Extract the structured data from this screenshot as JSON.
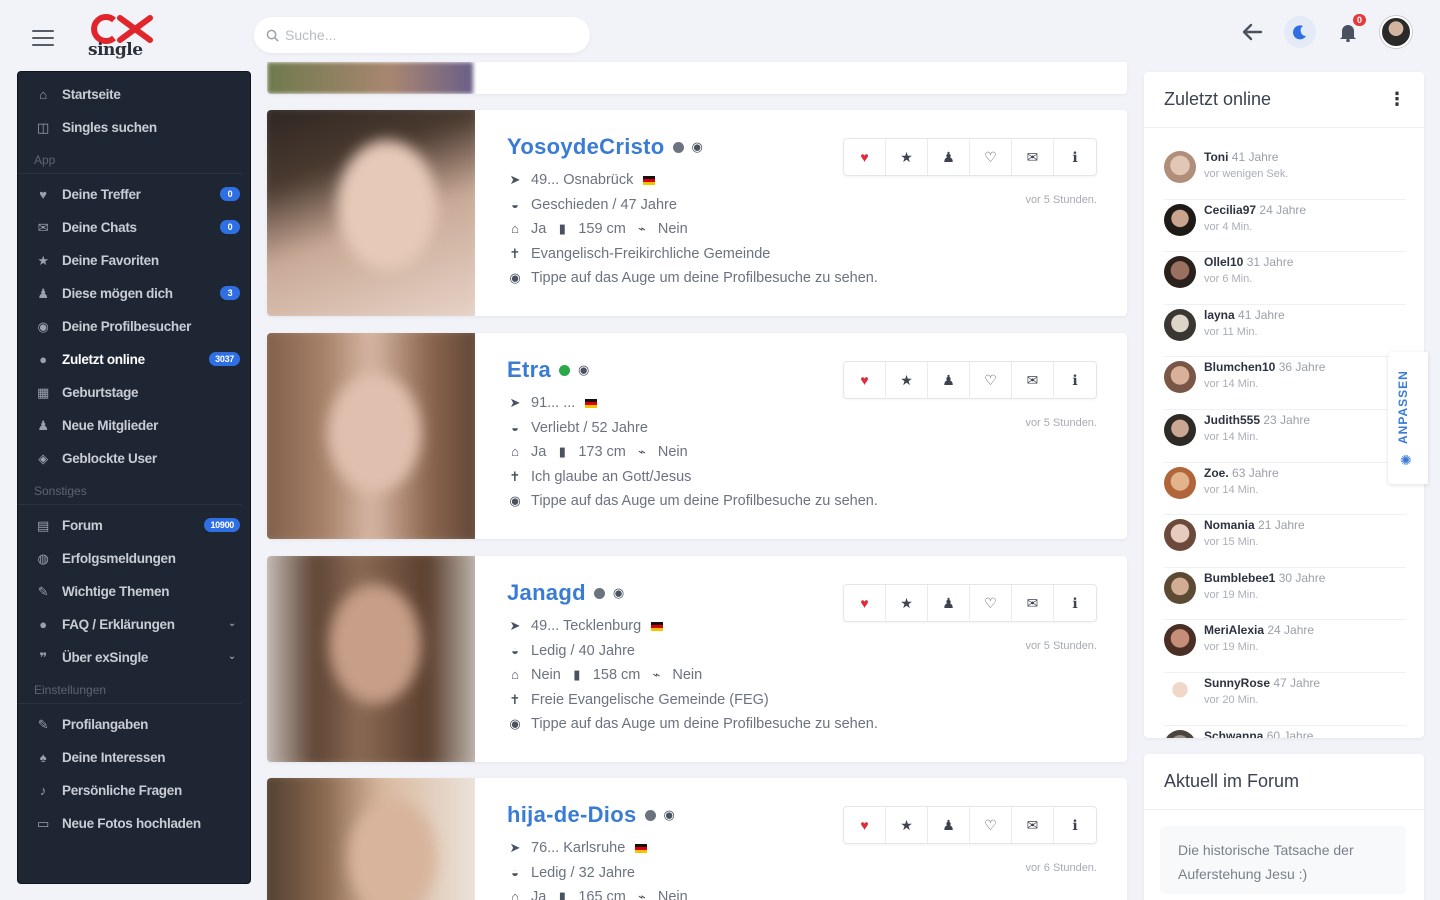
{
  "header": {
    "logo_text": "single",
    "search_placeholder": "Suche...",
    "notification_count": "0"
  },
  "sidebar": {
    "items": [
      {
        "label": "Startseite",
        "icon": "home-icon"
      },
      {
        "label": "Singles suchen",
        "icon": "binoculars-icon"
      }
    ],
    "sections": [
      {
        "title": "App",
        "items": [
          {
            "label": "Deine Treffer",
            "icon": "heart-icon",
            "count": "0"
          },
          {
            "label": "Deine Chats",
            "icon": "chat-icon",
            "count": "0"
          },
          {
            "label": "Deine Favoriten",
            "icon": "star-icon"
          },
          {
            "label": "Diese mögen dich",
            "icon": "user-icon",
            "count": "3"
          },
          {
            "label": "Deine Profilbesucher",
            "icon": "eye-icon"
          },
          {
            "label": "Zuletzt online",
            "icon": "clock-icon",
            "count": "3037",
            "active": true
          },
          {
            "label": "Geburtstage",
            "icon": "cake-icon"
          },
          {
            "label": "Neue Mitglieder",
            "icon": "users-icon"
          },
          {
            "label": "Geblockte User",
            "icon": "shield-icon"
          }
        ]
      },
      {
        "title": "Sonstiges",
        "items": [
          {
            "label": "Forum",
            "icon": "forum-icon",
            "count": "10900"
          },
          {
            "label": "Erfolgsmeldungen",
            "icon": "globe-icon"
          },
          {
            "label": "Wichtige Themen",
            "icon": "pin-icon"
          },
          {
            "label": "FAQ / Erklärungen",
            "icon": "bulb-icon",
            "chevron": true
          },
          {
            "label": "Über exSingle",
            "icon": "quote-icon",
            "chevron": true
          }
        ]
      },
      {
        "title": "Einstellungen",
        "items": [
          {
            "label": "Profilangaben",
            "icon": "edit-icon"
          },
          {
            "label": "Deine Interessen",
            "icon": "interests-icon"
          },
          {
            "label": "Persönliche Fragen",
            "icon": "mic-icon"
          },
          {
            "label": "Neue Fotos hochladen",
            "icon": "image-icon"
          }
        ]
      }
    ]
  },
  "profiles": [
    {
      "name": "YosoydeCristo",
      "status": "grey",
      "location": "49... Osnabrück",
      "relationship": "Geschieden / 47 Jahre",
      "children": "Ja",
      "height": "159 cm",
      "smoker": "Nein",
      "religion": "Evangelisch-Freikirchliche Gemeinde",
      "hint": "Tippe auf das Auge um deine Profilbesuche zu sehen.",
      "ago": "vor 5 Stunden."
    },
    {
      "name": "Etra",
      "status": "green",
      "location": "91... ...",
      "relationship": "Verliebt / 52 Jahre",
      "children": "Ja",
      "height": "173 cm",
      "smoker": "Nein",
      "religion": "Ich glaube an Gott/Jesus",
      "hint": "Tippe auf das Auge um deine Profilbesuche zu sehen.",
      "ago": "vor 5 Stunden."
    },
    {
      "name": "Janagd",
      "status": "grey",
      "location": "49... Tecklenburg",
      "relationship": "Ledig / 40 Jahre",
      "children": "Nein",
      "height": "158 cm",
      "smoker": "Nein",
      "religion": "Freie Evangelische Gemeinde (FEG)",
      "hint": "Tippe auf das Auge um deine Profilbesuche zu sehen.",
      "ago": "vor 5 Stunden."
    },
    {
      "name": "hija-de-Dios",
      "status": "grey",
      "location": "76... Karlsruhe",
      "relationship": "Ledig / 32 Jahre",
      "children": "Ja",
      "height": "165 cm",
      "smoker": "Nein",
      "religion": "",
      "hint": "",
      "ago": "vor 6 Stunden."
    }
  ],
  "online_panel": {
    "title": "Zuletzt online",
    "users": [
      {
        "name": "Toni",
        "age": "41 Jahre",
        "time": "vor wenigen Sek."
      },
      {
        "name": "Cecilia97",
        "age": "24 Jahre",
        "time": "vor 4 Min."
      },
      {
        "name": "Ollel10",
        "age": "31 Jahre",
        "time": "vor 6 Min."
      },
      {
        "name": "layna",
        "age": "41 Jahre",
        "time": "vor 11 Min."
      },
      {
        "name": "Blumchen10",
        "age": "36 Jahre",
        "time": "vor 14 Min."
      },
      {
        "name": "Judith555",
        "age": "23 Jahre",
        "time": "vor 14 Min."
      },
      {
        "name": "Zoe.",
        "age": "63 Jahre",
        "time": "vor 14 Min."
      },
      {
        "name": "Nomania",
        "age": "21 Jahre",
        "time": "vor 15 Min."
      },
      {
        "name": "Bumblebee1",
        "age": "30 Jahre",
        "time": "vor 19 Min."
      },
      {
        "name": "MeriAlexia",
        "age": "24 Jahre",
        "time": "vor 19 Min."
      },
      {
        "name": "SunnyRose",
        "age": "47 Jahre",
        "time": "vor 20 Min."
      },
      {
        "name": "Schwanna",
        "age": "60 Jahre",
        "time": ""
      }
    ]
  },
  "forum_panel": {
    "title": "Aktuell im Forum",
    "post": "Die historische Tatsache der Auferstehung Jesu :)"
  },
  "customize_tab": "ANPASSEN"
}
